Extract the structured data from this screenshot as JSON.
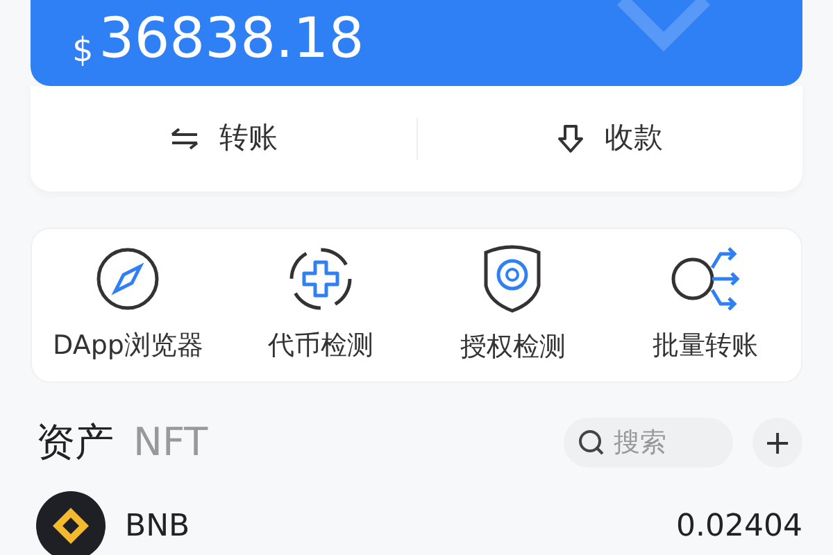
{
  "balance": {
    "currency": "$",
    "amount": "36838.18"
  },
  "actions": [
    {
      "kind": "transfer",
      "label": "转账"
    },
    {
      "kind": "receive",
      "label": "收款"
    }
  ],
  "tools": [
    {
      "kind": "compass",
      "label": "DApp浏览器"
    },
    {
      "kind": "token",
      "label": "代币检测"
    },
    {
      "kind": "shield",
      "label": "授权检测"
    },
    {
      "kind": "batch",
      "label": "批量转账"
    }
  ],
  "tabs": [
    {
      "label": "资产",
      "selected": true
    },
    {
      "label": "NFT",
      "selected": false
    }
  ],
  "search": {
    "placeholder": "搜索"
  },
  "add_button": "+",
  "assets": [
    {
      "name": "BNB",
      "amount": "0.02404"
    }
  ]
}
